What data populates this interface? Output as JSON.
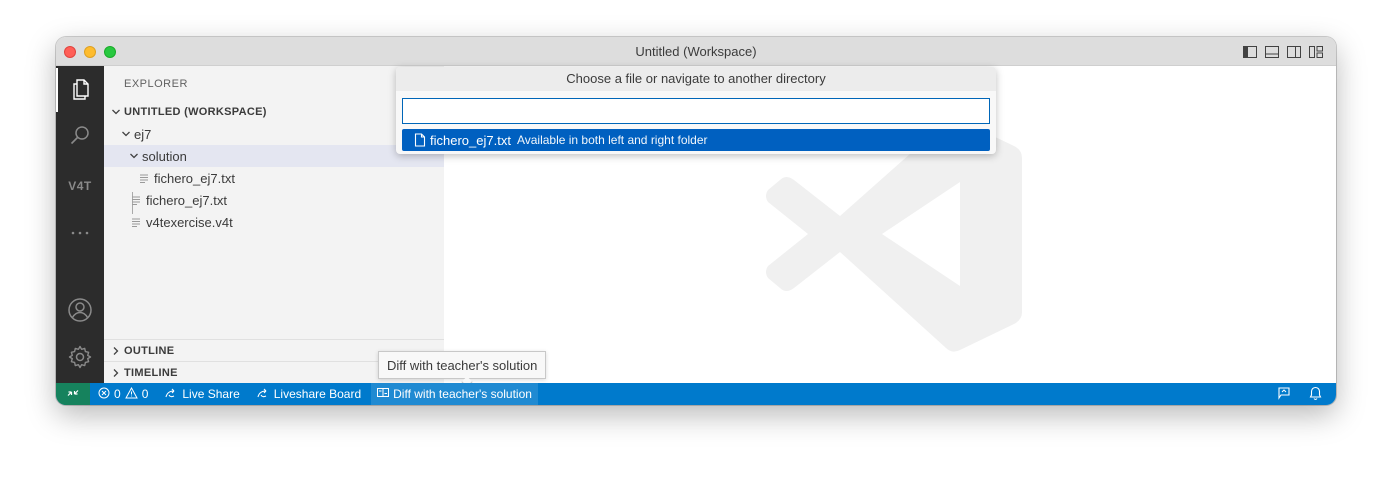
{
  "window": {
    "title": "Untitled (Workspace)"
  },
  "activity_bar": {
    "items": [
      {
        "name": "explorer",
        "icon": "files-icon"
      },
      {
        "name": "search",
        "icon": "search-icon"
      },
      {
        "name": "v4t",
        "label": "V4T"
      },
      {
        "name": "more",
        "icon": "ellipsis-icon"
      },
      {
        "name": "accounts",
        "icon": "account-icon"
      },
      {
        "name": "manage",
        "icon": "gear-icon"
      }
    ]
  },
  "sidebar": {
    "title": "EXPLORER",
    "workspace": "UNTITLED (WORKSPACE)",
    "tree": {
      "folder": "ej7",
      "subfolder": "solution",
      "subfolder_file": "fichero_ej7.txt",
      "files": [
        "fichero_ej7.txt",
        "v4texercise.v4t"
      ]
    },
    "panels": [
      "OUTLINE",
      "TIMELINE"
    ]
  },
  "quick_pick": {
    "title": "Choose a file or navigate to another directory",
    "input_value": "",
    "items": [
      {
        "label": "fichero_ej7.txt",
        "description": "Available in both left and right folder",
        "icon": "file-icon"
      }
    ]
  },
  "tooltip": {
    "text": "Diff with teacher's solution"
  },
  "status_bar": {
    "errors": "0",
    "warnings": "0",
    "live_share": "Live Share",
    "liveshare_board": "Liveshare Board",
    "diff": "Diff with teacher's solution"
  },
  "colors": {
    "status_bar": "#007acc",
    "remote": "#16825d",
    "selection": "#0060c0",
    "activity_bar": "#2c2c2c",
    "sidebar": "#f3f3f3"
  }
}
